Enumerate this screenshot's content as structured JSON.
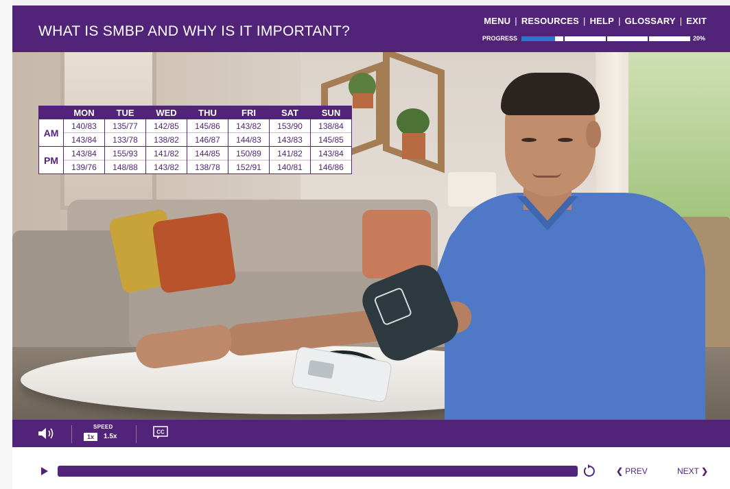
{
  "header": {
    "title": "WHAT IS SMBP AND WHY IS IT IMPORTANT?",
    "nav": [
      {
        "label": "MENU"
      },
      {
        "label": "RESOURCES"
      },
      {
        "label": "HELP"
      },
      {
        "label": "GLOSSARY"
      },
      {
        "label": "EXIT"
      }
    ],
    "progress": {
      "label": "PROGRESS",
      "percent_text": "20%",
      "fraction": 0.2,
      "segments": 4
    }
  },
  "bp_table": {
    "days": [
      "MON",
      "TUE",
      "WED",
      "THU",
      "FRI",
      "SAT",
      "SUN"
    ],
    "rows": [
      {
        "period": "AM",
        "readings": [
          [
            "140/83",
            "135/77",
            "142/85",
            "145/86",
            "143/82",
            "153/90",
            "138/84"
          ],
          [
            "143/84",
            "133/78",
            "138/82",
            "146/87",
            "144/83",
            "143/83",
            "145/85"
          ]
        ]
      },
      {
        "period": "PM",
        "readings": [
          [
            "143/84",
            "155/93",
            "141/82",
            "144/85",
            "150/89",
            "141/82",
            "143/84"
          ],
          [
            "139/76",
            "148/88",
            "143/82",
            "138/78",
            "152/91",
            "140/81",
            "146/86"
          ]
        ]
      }
    ]
  },
  "media_bar": {
    "speed_label": "SPEED",
    "speed_options": [
      "1x",
      "1.5x"
    ],
    "speed_selected": "1x",
    "cc_label": "CC"
  },
  "player": {
    "prev_label": "PREV",
    "next_label": "NEXT"
  },
  "colors": {
    "brand_purple": "#51247a",
    "progress_blue": "#2d77c9"
  }
}
